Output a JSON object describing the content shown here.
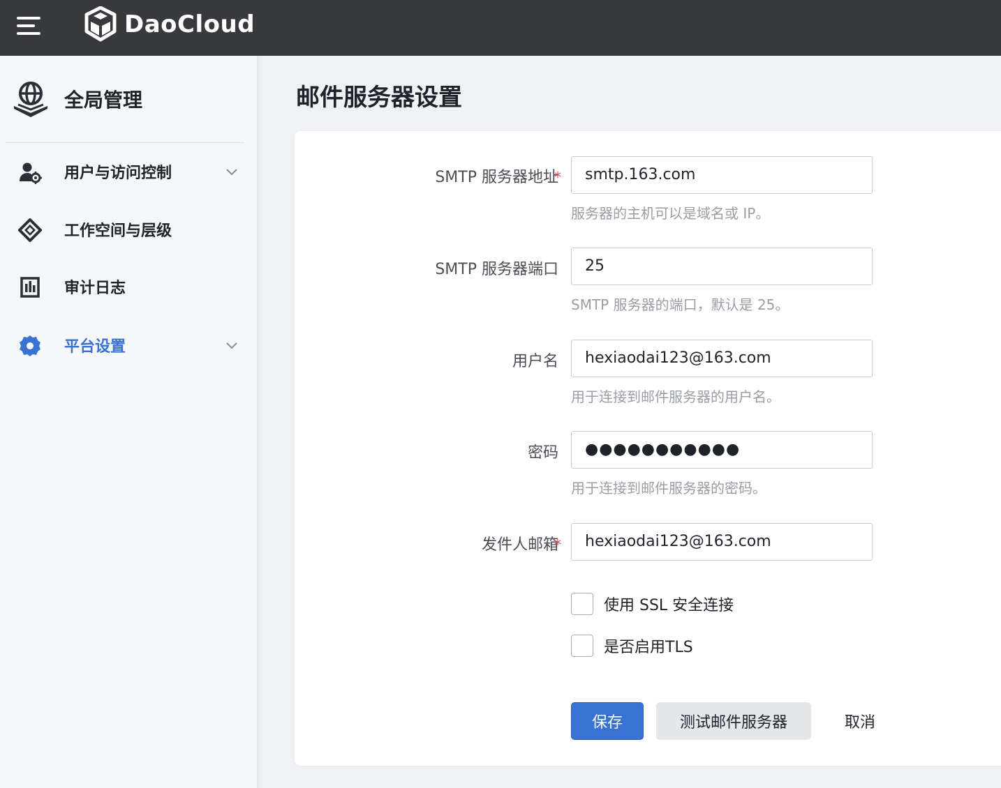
{
  "app": {
    "brand": "DaoCloud"
  },
  "sidebar": {
    "section_title": "全局管理",
    "items": [
      {
        "label": "用户与访问控制",
        "icon": "user-gear-icon",
        "expandable": true,
        "active": false
      },
      {
        "label": "工作空间与层级",
        "icon": "workspace-icon",
        "expandable": false,
        "active": false
      },
      {
        "label": "审计日志",
        "icon": "audit-chart-icon",
        "expandable": false,
        "active": false
      },
      {
        "label": "平台设置",
        "icon": "gear-icon",
        "expandable": true,
        "active": true
      }
    ]
  },
  "page": {
    "title": "邮件服务器设置"
  },
  "form": {
    "smtp_host": {
      "label": "SMTP 服务器地址",
      "required": "*",
      "value": "smtp.163.com",
      "help": "服务器的主机可以是域名或 IP。"
    },
    "smtp_port": {
      "label": "SMTP 服务器端口",
      "value": "25",
      "help": "SMTP 服务器的端口，默认是 25。"
    },
    "username": {
      "label": "用户名",
      "value": "hexiaodai123@163.com",
      "help": "用于连接到邮件服务器的用户名。"
    },
    "password": {
      "label": "密码",
      "value": "●●●●●●●●●●●",
      "help": "用于连接到邮件服务器的密码。"
    },
    "sender": {
      "label": "发件人邮箱",
      "required": "*",
      "value": "hexiaodai123@163.com"
    },
    "use_ssl": {
      "label": "使用 SSL 安全连接",
      "checked": false
    },
    "use_tls": {
      "label": "是否启用TLS",
      "checked": false
    }
  },
  "actions": {
    "save": "保存",
    "test": "测试邮件服务器",
    "cancel": "取消"
  },
  "colors": {
    "accent": "#3a72d3",
    "topbar": "#38393d",
    "required": "#e5484d"
  }
}
